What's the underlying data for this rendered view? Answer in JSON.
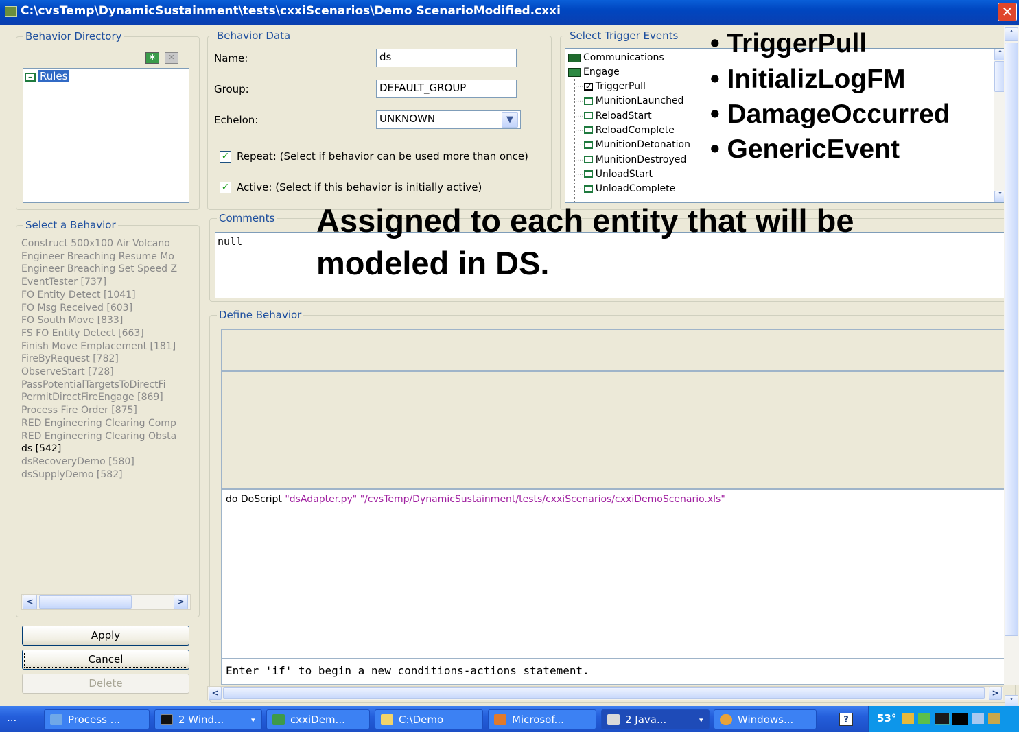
{
  "window": {
    "title": "C:\\cvsTemp\\DynamicSustainment\\tests\\cxxiScenarios\\Demo ScenarioModified.cxxi",
    "close": "✕"
  },
  "behavior_directory": {
    "legend": "Behavior Directory",
    "root_label": "Rules"
  },
  "select_behavior": {
    "legend": "Select a Behavior",
    "items": [
      "Construct 500x100 Air Volcano",
      "Engineer Breaching Resume Mo",
      "Engineer Breaching Set Speed Z",
      "EventTester [737]",
      "FO Entity Detect [1041]",
      "FO Msg Received [603]",
      "FO South Move [833]",
      "FS FO Entity Detect [663]",
      "Finish Move Emplacement [181]",
      "FireByRequest [782]",
      "ObserveStart [728]",
      "PassPotentialTargetsToDirectFi",
      "PermitDirectFireEngage [869]",
      "Process Fire Order [875]",
      "RED Engineering Clearing Comp",
      "RED Engineering Clearing Obsta",
      "ds [542]",
      "dsRecoveryDemo [580]",
      "dsSupplyDemo [582]"
    ],
    "selected_index": 16
  },
  "buttons": {
    "apply": "Apply",
    "cancel": "Cancel",
    "delete": "Delete"
  },
  "behavior_data": {
    "legend": "Behavior Data",
    "name_label": "Name:",
    "name_value": "ds",
    "group_label": "Group:",
    "group_value": "DEFAULT_GROUP",
    "echelon_label": "Echelon:",
    "echelon_value": "UNKNOWN",
    "repeat_label": "Repeat: (Select if behavior can be used more than once)",
    "repeat_checked": true,
    "active_label": "Active: (Select if this behavior is initially active)",
    "active_checked": true
  },
  "trigger_events": {
    "legend": "Select Trigger Events",
    "folders": [
      "Communications",
      "Engage"
    ],
    "engage_items": [
      "TriggerPull",
      "MunitionLaunched",
      "ReloadStart",
      "ReloadComplete",
      "MunitionDetonation",
      "MunitionDestroyed",
      "UnloadStart",
      "UnloadComplete"
    ],
    "checked_item": "TriggerPull"
  },
  "comments": {
    "legend": "Comments",
    "value": "null"
  },
  "define_behavior": {
    "legend": "Define Behavior",
    "script_prefix": "do DoScript",
    "script_arg1": "\"dsAdapter.py\"",
    "script_arg2": "\"/cvsTemp/DynamicSustainment/tests/cxxiScenarios/cxxiDemoScenario.xls\"",
    "hint": "Enter 'if' to begin a new conditions-actions statement."
  },
  "overlay": {
    "bullets": [
      "• TriggerPull",
      "• InitializLogFM",
      "• DamageOccurred",
      "• GenericEvent"
    ],
    "note_line1": "Assigned to each entity that will be",
    "note_line2": "modeled in DS."
  },
  "taskbar": {
    "start_dots": "...",
    "tasks": [
      "Process ...",
      "2 Wind...",
      "cxxiDem...",
      "C:\\Demo",
      "Microsof...",
      "2 Java...",
      "Windows..."
    ],
    "tray_temp": "53°"
  }
}
